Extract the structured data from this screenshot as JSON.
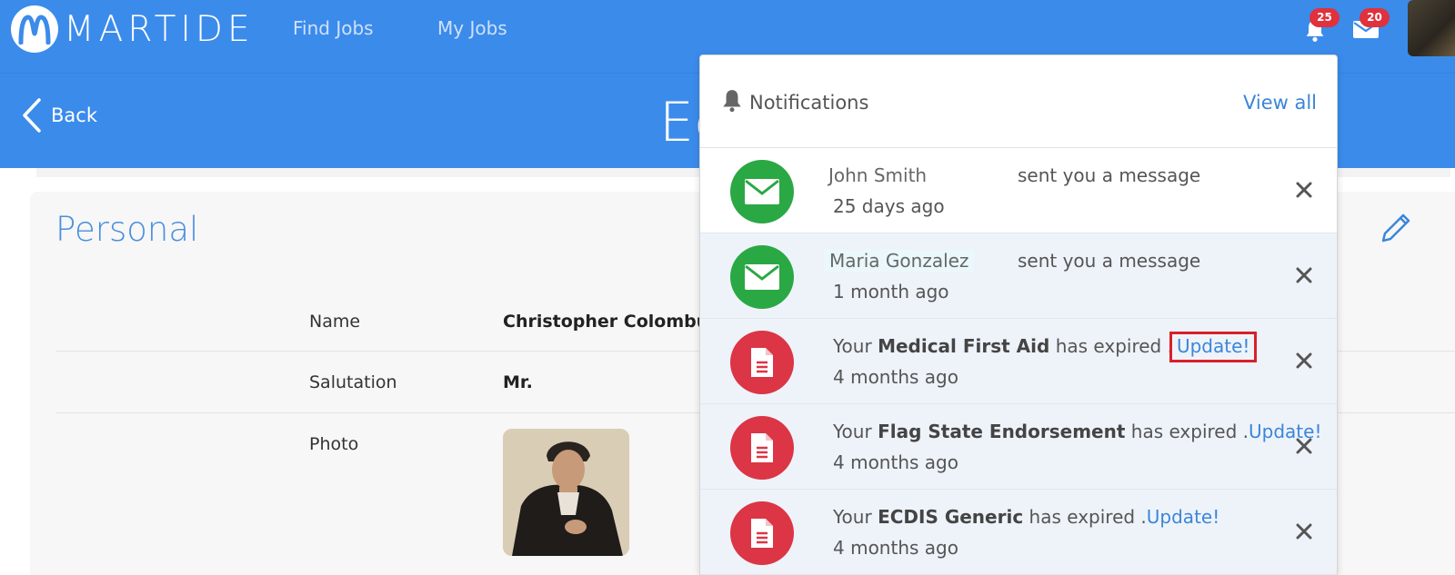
{
  "brand": {
    "name": "MARTIDE"
  },
  "nav": {
    "find_jobs": "Find Jobs",
    "my_jobs": "My Jobs"
  },
  "badges": {
    "notifications": "25",
    "messages": "20"
  },
  "header": {
    "back_label": "Back",
    "title": "Ed"
  },
  "section": {
    "title": "Personal",
    "fields": [
      {
        "label": "Name",
        "value": "Christopher Colombu"
      },
      {
        "label": "Salutation",
        "value": "Mr."
      },
      {
        "label": "Photo",
        "value": ""
      }
    ]
  },
  "notifications": {
    "title": "Notifications",
    "view_all": "View all",
    "items": [
      {
        "sender": "John Smith",
        "action": "sent you a message",
        "time": "25 days ago",
        "icon": "envelope-icon"
      },
      {
        "sender": "Maria Gonzalez",
        "action": "sent you a message",
        "time": "1 month ago",
        "icon": "envelope-icon"
      },
      {
        "prefix": "Your",
        "document": "Medical First Aid",
        "suffix": "has expired .",
        "link": "Update!",
        "time": "4 months ago",
        "icon": "document-icon"
      },
      {
        "prefix": "Your",
        "document": "Flag State Endorsement",
        "suffix": "has expired .",
        "link": "Update!",
        "time": "4 months ago",
        "icon": "document-icon"
      },
      {
        "prefix": "Your",
        "document": "ECDIS Generic",
        "suffix": "has expired .",
        "link": "Update!",
        "time": "4 months ago",
        "icon": "document-icon"
      }
    ]
  },
  "colors": {
    "primary": "#3b8beb",
    "badge": "#e0313c",
    "message_icon": "#2aa844",
    "document_icon": "#dc3545",
    "link": "#3b86d8",
    "highlight_box": "#d8202b"
  }
}
